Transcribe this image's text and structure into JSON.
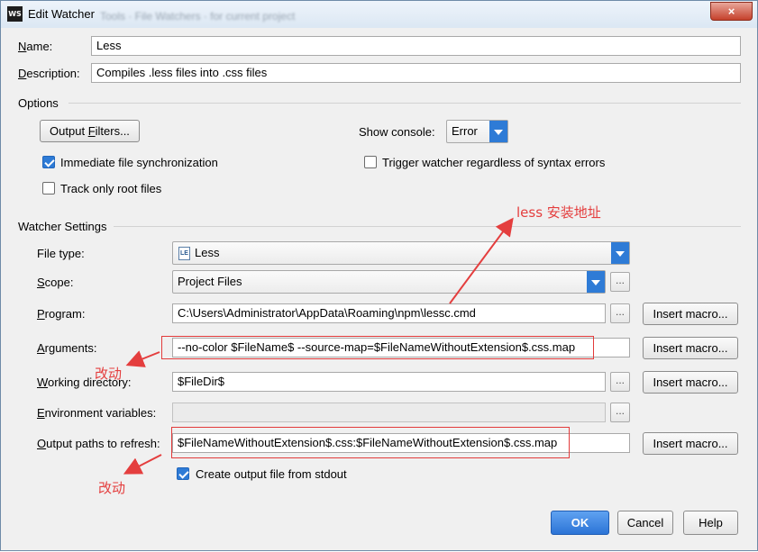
{
  "titlebar": {
    "title": "Edit Watcher",
    "app_icon": "WS",
    "ghost_title": "Tools · File Watchers   · for current project",
    "close_icon": "×"
  },
  "name": {
    "label_prefix": "",
    "label_key": "N",
    "label_rest": "ame:",
    "value": "Less"
  },
  "description": {
    "label_key": "D",
    "label_rest": "escription:",
    "value": "Compiles .less files into .css files"
  },
  "options": {
    "title": "Options",
    "output_filters_prefix": "Output ",
    "output_filters_key": "F",
    "output_filters_rest": "ilters...",
    "show_console_label": "Show console:",
    "show_console_value": "Error",
    "immediate_sync": {
      "label": "Immediate file synchronization",
      "checked": true
    },
    "trigger_watcher": {
      "label": "Trigger watcher regardless of syntax errors",
      "checked": false
    },
    "track_root": {
      "label": "Track only root files",
      "checked": false
    }
  },
  "watcher": {
    "title": "Watcher Settings",
    "file_type": {
      "label": "File type:",
      "value": "Less",
      "icon": "LE"
    },
    "scope": {
      "label_key": "S",
      "label_rest": "cope:",
      "value": "Project Files"
    },
    "program": {
      "label_key": "P",
      "label_rest": "rogram:",
      "value": "C:\\Users\\Administrator\\AppData\\Roaming\\npm\\lessc.cmd"
    },
    "arguments": {
      "label_key": "A",
      "label_rest": "rguments:",
      "value": "--no-color $FileName$ --source-map=$FileNameWithoutExtension$.css.map"
    },
    "working_dir": {
      "label_prefix": "",
      "label_key": "W",
      "label_rest": "orking directory:",
      "value": "$FileDir$"
    },
    "env_vars": {
      "label_key": "E",
      "label_rest": "nvironment variables:",
      "value": ""
    },
    "output_paths": {
      "label_key": "O",
      "label_rest": "utput paths to refresh:",
      "value": "$FileNameWithoutExtension$.css:$FileNameWithoutExtension$.css.map"
    },
    "create_output": {
      "label": "Create output file from stdout",
      "checked": true
    },
    "insert_macro": "Insert macro...",
    "browse": "..."
  },
  "buttons": {
    "ok": "OK",
    "cancel": "Cancel",
    "help": "Help"
  },
  "annotations": {
    "less_path": "less 安装地址",
    "changed_1": "改动",
    "changed_2": "改动",
    "color": "#e43e3e"
  }
}
